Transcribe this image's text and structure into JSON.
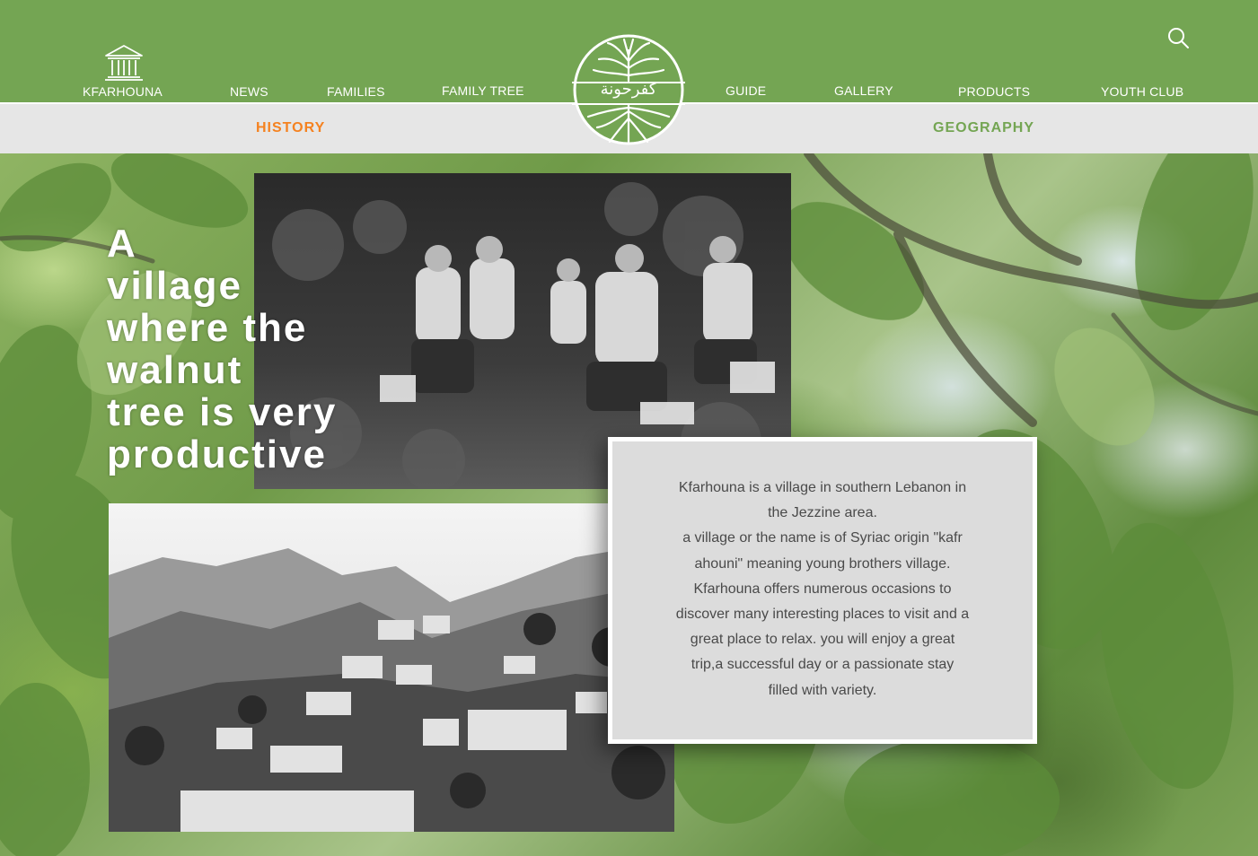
{
  "nav": {
    "home_label": "KFARHOUNA",
    "items": [
      {
        "label": "NEWS"
      },
      {
        "label": "FAMILIES"
      },
      {
        "label": "FAMILY TREE"
      },
      {
        "label": "GUIDE"
      },
      {
        "label": "GALLERY"
      },
      {
        "label": "PRODUCTS"
      },
      {
        "label": "YOUTH CLUB"
      }
    ],
    "logo_text": "كفرحونة"
  },
  "subnav": {
    "history": "HISTORY",
    "geography": "GEOGRAPHY"
  },
  "headline": [
    "A",
    "village",
    "where the",
    "walnut",
    "tree is very",
    "productive"
  ],
  "info": {
    "lines": [
      "Kfarhouna is a village in southern Lebanon in",
      "the Jezzine area.",
      "a village or the name is of Syriac origin \"kafr",
      "ahouni\" meaning young brothers village.",
      "Kfarhouna offers numerous occasions to",
      "discover many interesting places to visit and a",
      "great place to relax. you will enjoy a great",
      "trip,a successful day or a passionate stay",
      "filled with variety."
    ]
  },
  "colors": {
    "header_green": "#74a553",
    "subnav_gray": "#e6e6e6",
    "history_orange": "#f58220",
    "geography_green": "#74a553"
  },
  "icons": {
    "home": "museum-building-icon",
    "search": "search-icon",
    "logo": "walnut-tree-logo"
  }
}
